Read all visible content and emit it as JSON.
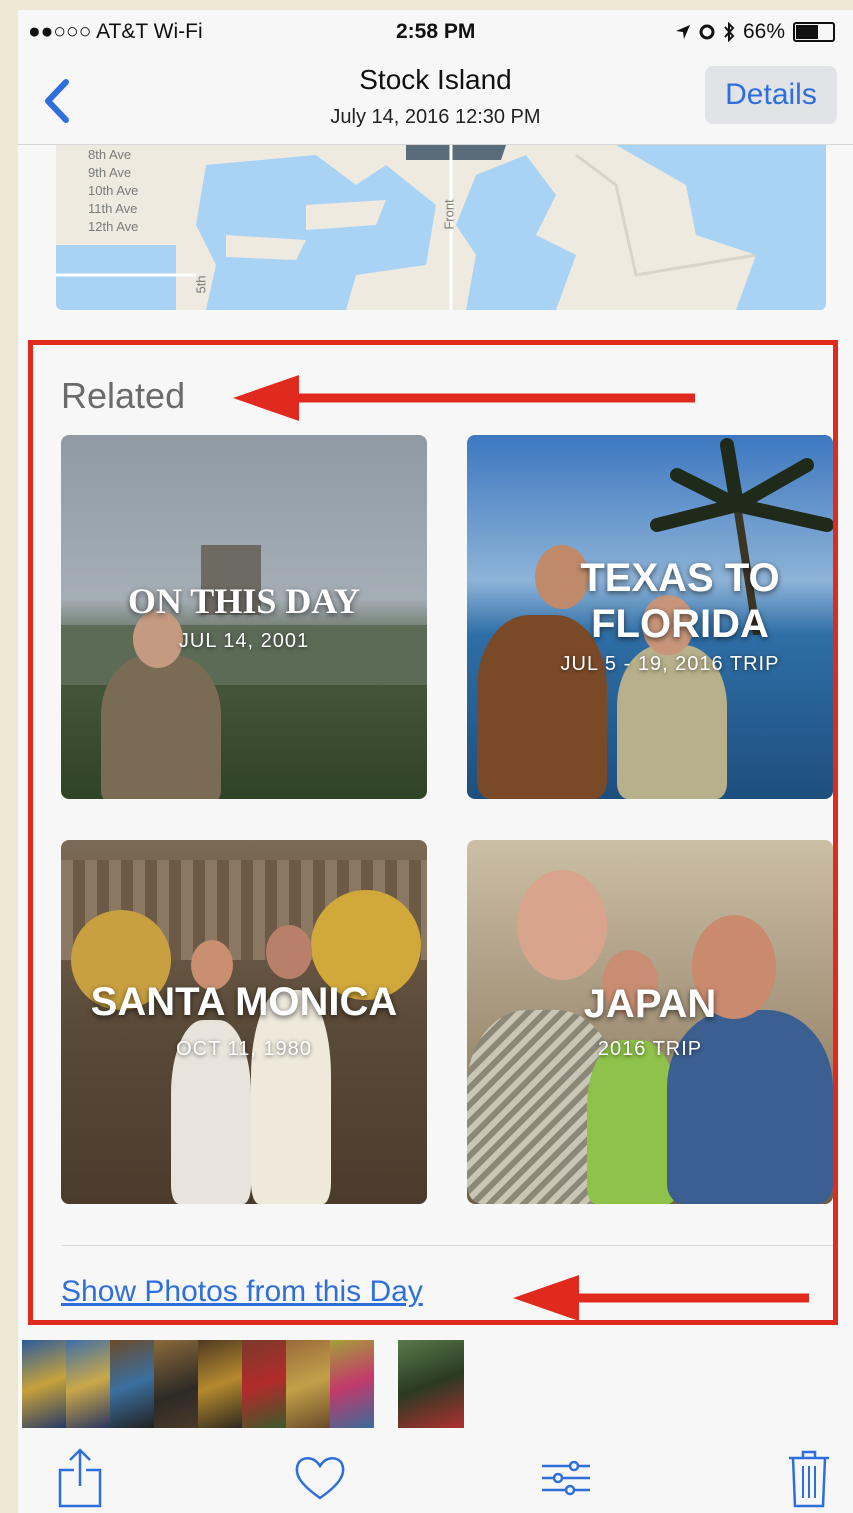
{
  "status_bar": {
    "carrier": "●●○○○ AT&T Wi-Fi",
    "time": "2:58 PM",
    "battery": "66%",
    "battery_level": 0.66
  },
  "nav": {
    "title": "Stock Island",
    "subtitle": "July 14, 2016  12:30 PM",
    "details_label": "Details",
    "back_icon": "chevron-left-icon"
  },
  "map": {
    "street_labels": [
      "8th Ave",
      "9th Ave",
      "10th Ave",
      "11th Ave",
      "12th Ave",
      "Front",
      "5th"
    ]
  },
  "related": {
    "title": "Related",
    "memories": [
      {
        "title": "ON THIS DAY",
        "subtitle": "JUL 14, 2001"
      },
      {
        "title": "TEXAS TO FLORIDA",
        "subtitle": "JUL 5 - 19, 2016 TRIP"
      },
      {
        "title": "SANTA MONICA",
        "subtitle": "OCT 11, 1980"
      },
      {
        "title": "JAPAN",
        "subtitle": "2016 TRIP"
      }
    ],
    "show_photos_link": "Show Photos from this Day"
  },
  "toolbar": {
    "icons": [
      "share-icon",
      "heart-icon",
      "adjust-icon",
      "trash-icon"
    ]
  },
  "colors": {
    "accent": "#2f6fdc",
    "annotation_red": "#e02a1e"
  }
}
